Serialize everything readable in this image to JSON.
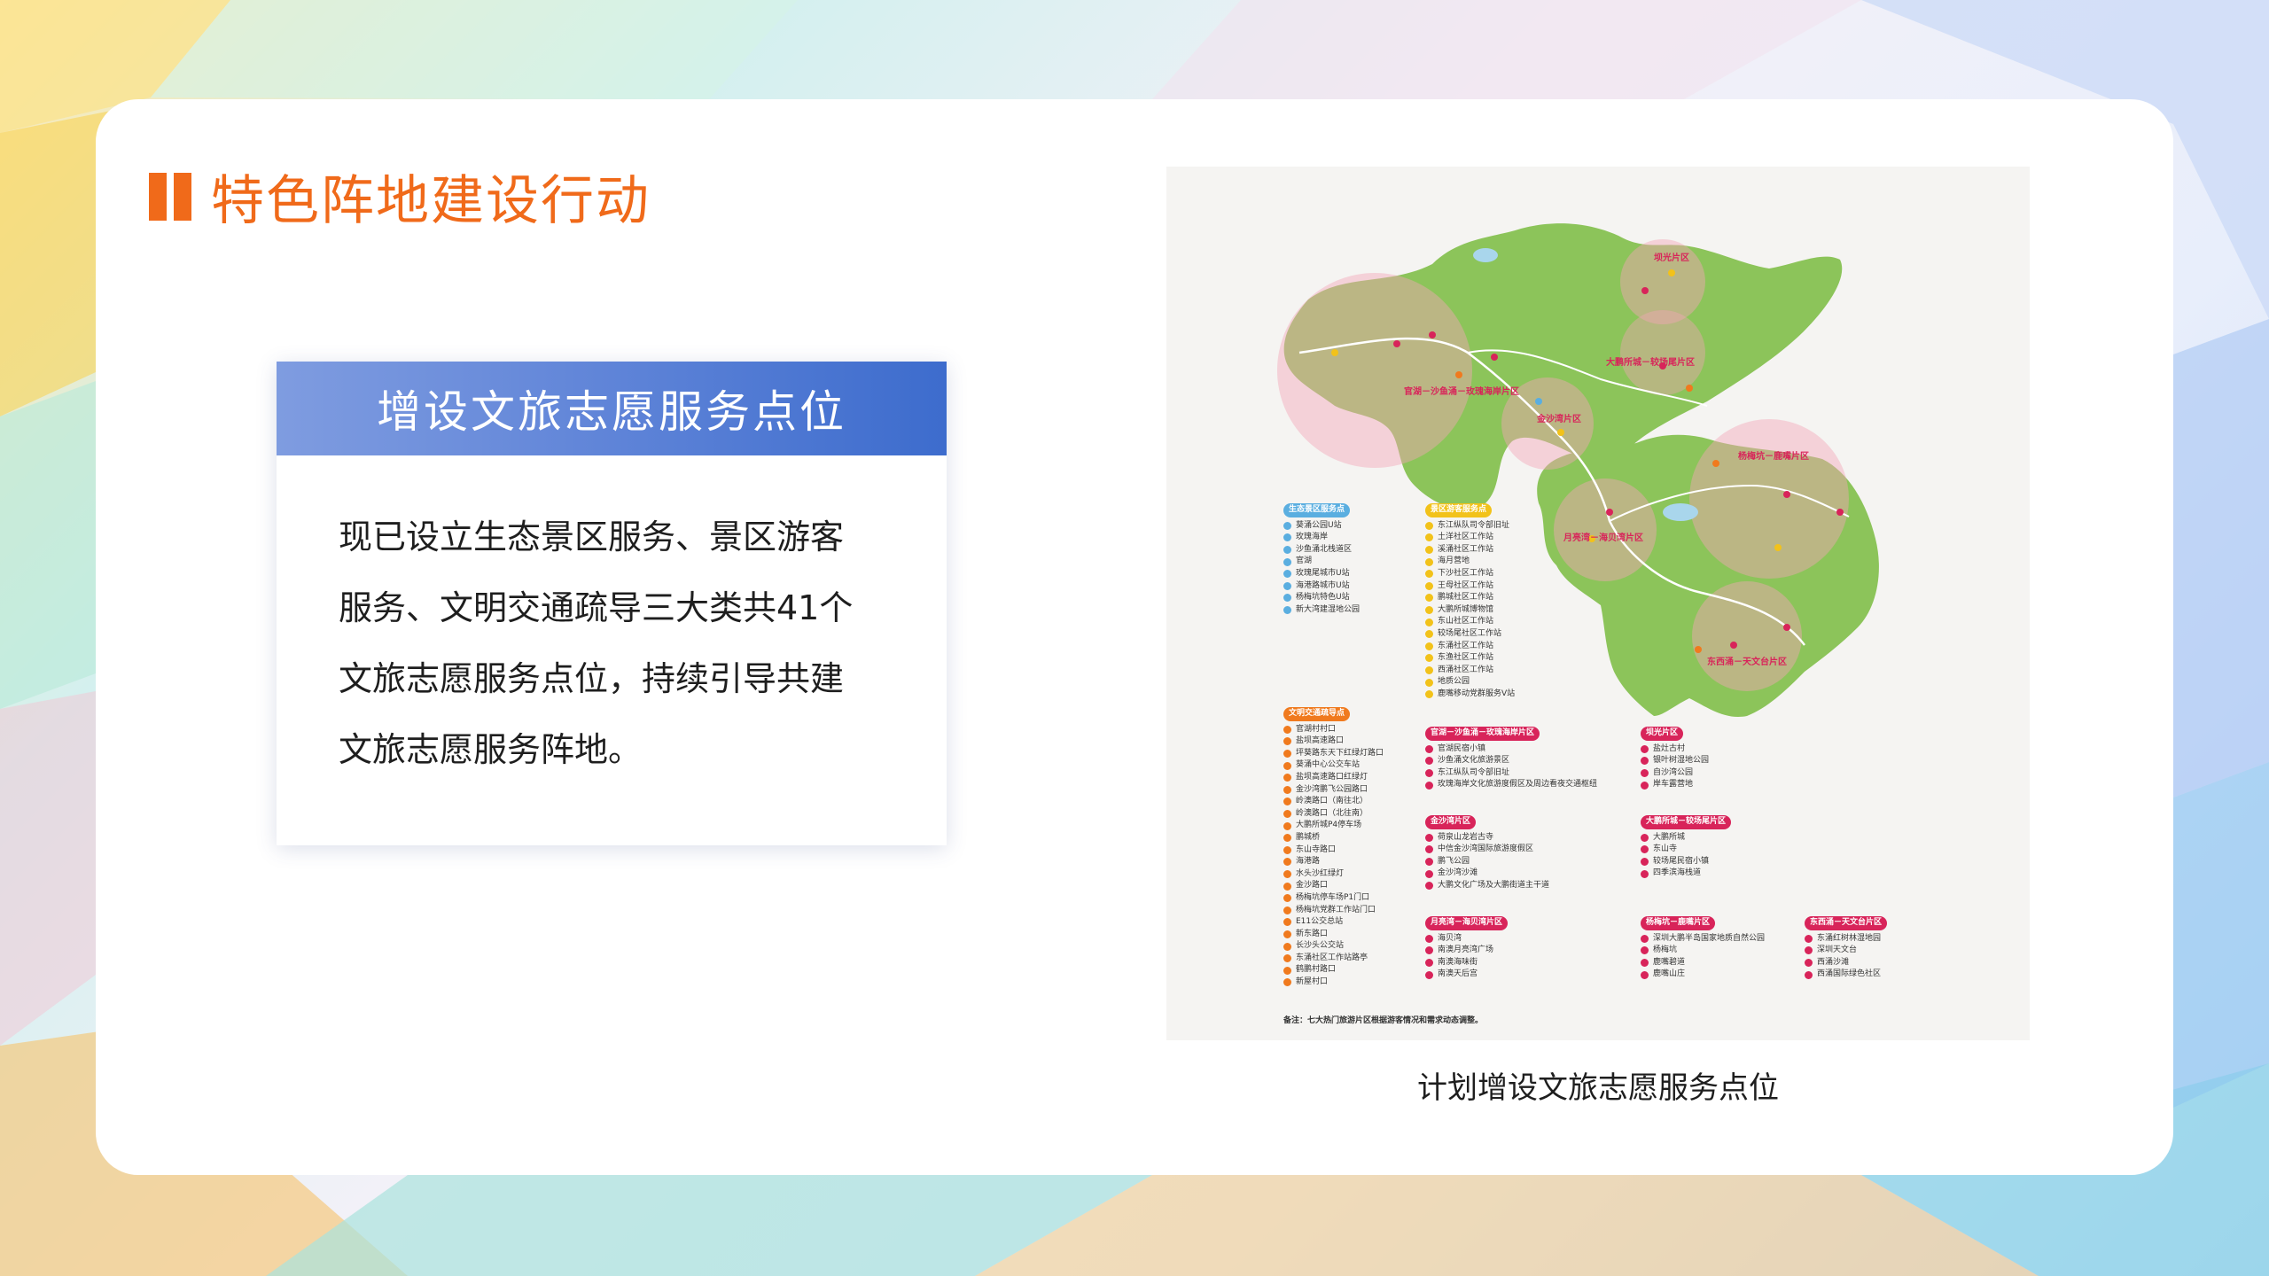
{
  "page": {
    "title": "特色阵地建设行动"
  },
  "info_box": {
    "heading": "增设文旅志愿服务点位",
    "body_lines": [
      "现已设立生态景区服务、景区游客",
      "服务、文明交通疏导三大类共41个",
      "文旅志愿服务点位，持续引导共建",
      "文旅志愿服务阵地。"
    ]
  },
  "map": {
    "caption": "计划增设文旅志愿服务点位",
    "note": "备注：七大热门旅游片区根据游客情况和需求动态调整。",
    "area_labels": [
      "坝光片区",
      "大鹏所城－较场尾片区",
      "官湖－沙鱼涌－玫瑰海岸片区",
      "金沙湾片区",
      "杨梅坑－鹿嘴片区",
      "月亮湾－海贝湾片区",
      "东西涌－天文台片区"
    ],
    "legends": [
      {
        "title": "生态景区服务点",
        "color": "#5aaee0",
        "items": [
          "葵涌公园U站",
          "玫瑰海岸",
          "沙鱼涌北栈道区",
          "官湖",
          "玫瑰尾城市U站",
          "海港路城市U站",
          "杨梅坑特色U站",
          "新大湾建湿地公园"
        ]
      },
      {
        "title": "景区游客服务点",
        "color": "#f2c21a",
        "items": [
          "东江纵队司令部旧址",
          "土洋社区工作站",
          "溪涌社区工作站",
          "海月营地",
          "下沙社区工作站",
          "王母社区工作站",
          "鹏城社区工作站",
          "大鹏所城博物馆",
          "东山社区工作站",
          "较场尾社区工作站",
          "东涌社区工作站",
          "东渔社区工作站",
          "西涌社区工作站",
          "地质公园",
          "鹿嘴移动党群服务V站"
        ]
      },
      {
        "title": "文明交通疏导点",
        "color": "#f07a1e",
        "items": [
          "官湖村村口",
          "盐坝高速路口",
          "坪葵路东天下红绿灯路口",
          "葵涌中心公交车站",
          "盐坝高速路口红绿灯",
          "金沙湾鹏飞公园路口",
          "岭澳路口（南往北）",
          "岭澳路口（北往南）",
          "大鹏所城P4停车场",
          "鹏城桥",
          "东山寺路口",
          "海港路",
          "水头沙红绿灯",
          "金沙路口",
          "杨梅坑停车场P1门口",
          "杨梅坑党群工作站门口",
          "E11公交总站",
          "新东路口",
          "长沙头公交站",
          "东涌社区工作站路亭",
          "鹤鹏村路口",
          "新屋村口"
        ]
      },
      {
        "title": "官湖－沙鱼涌－玫瑰海岸片区",
        "color": "#d8245a",
        "items": [
          "官湖民宿小镇",
          "沙鱼涌文化旅游景区",
          "东江纵队司令部旧址",
          "玫瑰海岸文化旅游度假区及周边看夜交通枢纽"
        ]
      },
      {
        "title": "坝光片区",
        "color": "#d8245a",
        "items": [
          "盐灶古村",
          "银叶树湿地公园",
          "自沙湾公园",
          "岸车露营地"
        ]
      },
      {
        "title": "金沙湾片区",
        "color": "#d8245a",
        "items": [
          "荷泉山龙岩古寺",
          "中信金沙湾国际旅游度假区",
          "鹏飞公园",
          "金沙湾沙滩",
          "大鹏文化广场及大鹏街道主干道"
        ]
      },
      {
        "title": "大鹏所城－较场尾片区",
        "color": "#d8245a",
        "items": [
          "大鹏所城",
          "东山寺",
          "较场尾民宿小镇",
          "四季滨海栈道"
        ]
      },
      {
        "title": "月亮湾－海贝湾片区",
        "color": "#d8245a",
        "items": [
          "海贝湾",
          "南澳月亮湾广场",
          "南澳海味街",
          "南澳天后宫"
        ]
      },
      {
        "title": "杨梅坑－鹿嘴片区",
        "color": "#d8245a",
        "items": [
          "深圳大鹏半岛国家地质自然公园",
          "杨梅坑",
          "鹿嘴碧道",
          "鹿嘴山庄"
        ]
      },
      {
        "title": "东西涌－天文台片区",
        "color": "#d8245a",
        "items": [
          "东涌红树林湿地园",
          "深圳天文台",
          "西涌沙滩",
          "西涌国际绿色社区"
        ]
      }
    ]
  },
  "colors": {
    "accent": "#f06a1a",
    "header_blue": "#4f78d3",
    "map_green": "#8cc45a",
    "area_pink": "#d8245a"
  }
}
